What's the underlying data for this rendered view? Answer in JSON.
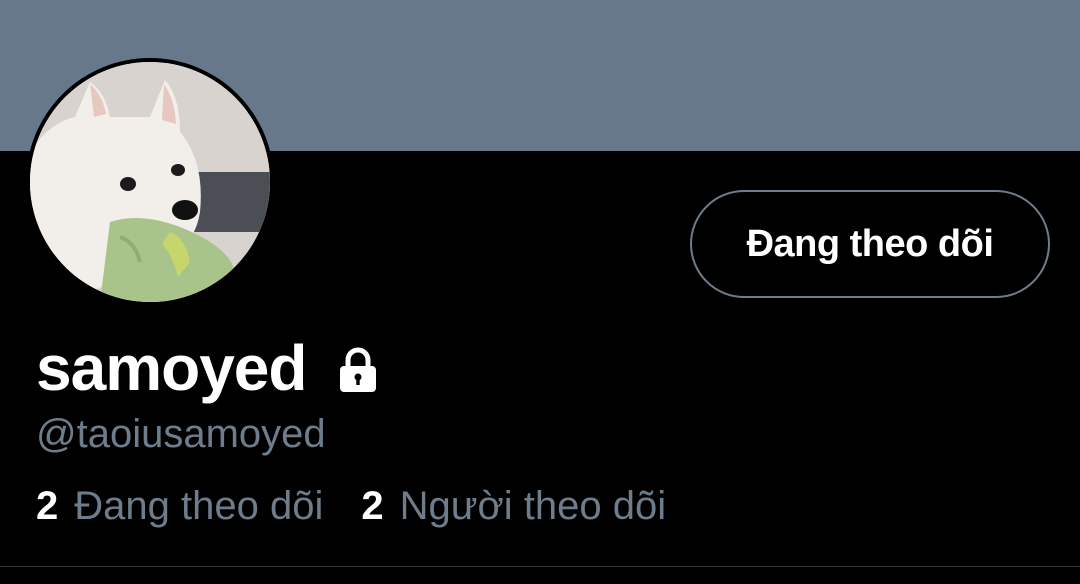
{
  "profile": {
    "display_name": "samoyed",
    "handle": "@taoiusamoyed",
    "is_protected": true,
    "follow_button_label": "Đang theo dõi",
    "following": {
      "count": "2",
      "label": "Đang theo dõi"
    },
    "followers": {
      "count": "2",
      "label": "Người theo dõi"
    }
  },
  "icons": {
    "lock": "lock-icon",
    "avatar": "samoyed-dog-avatar"
  },
  "colors": {
    "background": "#000000",
    "banner": "#66788a",
    "primary_text": "#ffffff",
    "secondary_text": "#6e7d8c",
    "button_border": "#6e7d8c"
  }
}
